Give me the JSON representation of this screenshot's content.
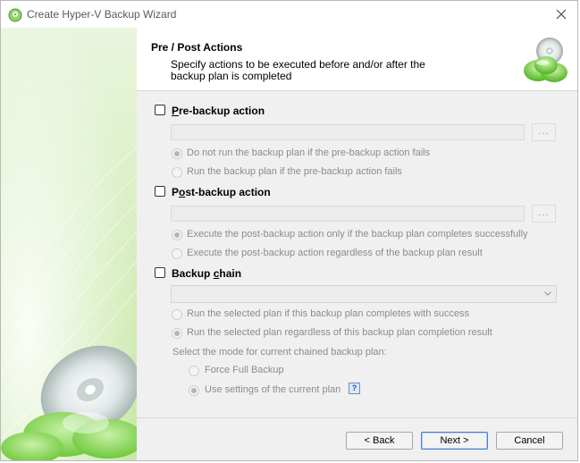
{
  "window": {
    "title": "Create Hyper-V Backup Wizard"
  },
  "header": {
    "title": "Pre / Post Actions",
    "subtitle_line1": "Specify actions to be executed before and/or after the",
    "subtitle_line2": "backup plan is completed"
  },
  "pre_backup": {
    "label_prefix": "",
    "label_mnemonic": "P",
    "label_rest": "re-backup action",
    "browse_label": "...",
    "options": [
      {
        "label": "Do not run the backup plan if the pre-backup action fails",
        "selected": true
      },
      {
        "label": "Run the backup plan if the pre-backup action fails",
        "selected": false
      }
    ]
  },
  "post_backup": {
    "label_prefix": "P",
    "label_mnemonic": "o",
    "label_rest": "st-backup action",
    "browse_label": "...",
    "options": [
      {
        "label": "Execute the post-backup action only if the backup plan completes successfully",
        "selected": true
      },
      {
        "label": "Execute the post-backup action regardless of the backup plan result",
        "selected": false
      }
    ]
  },
  "backup_chain": {
    "label_prefix": "Backup ",
    "label_mnemonic": "c",
    "label_rest": "hain",
    "options": [
      {
        "label": "Run the selected plan if this backup plan completes with success",
        "selected": false
      },
      {
        "label": "Run the selected plan regardless of this backup plan completion result",
        "selected": true
      }
    ],
    "mode_caption": "Select the mode for current chained backup plan:",
    "modes": [
      {
        "label": "Force Full Backup",
        "selected": false
      },
      {
        "label": "Use settings of the current plan",
        "selected": true
      }
    ],
    "help_label": "?"
  },
  "buttons": {
    "back": "< Back",
    "next": "Next >",
    "cancel": "Cancel"
  },
  "colors": {
    "accent_green": "#5cb82e",
    "default_button_border": "#4a7ec2"
  }
}
